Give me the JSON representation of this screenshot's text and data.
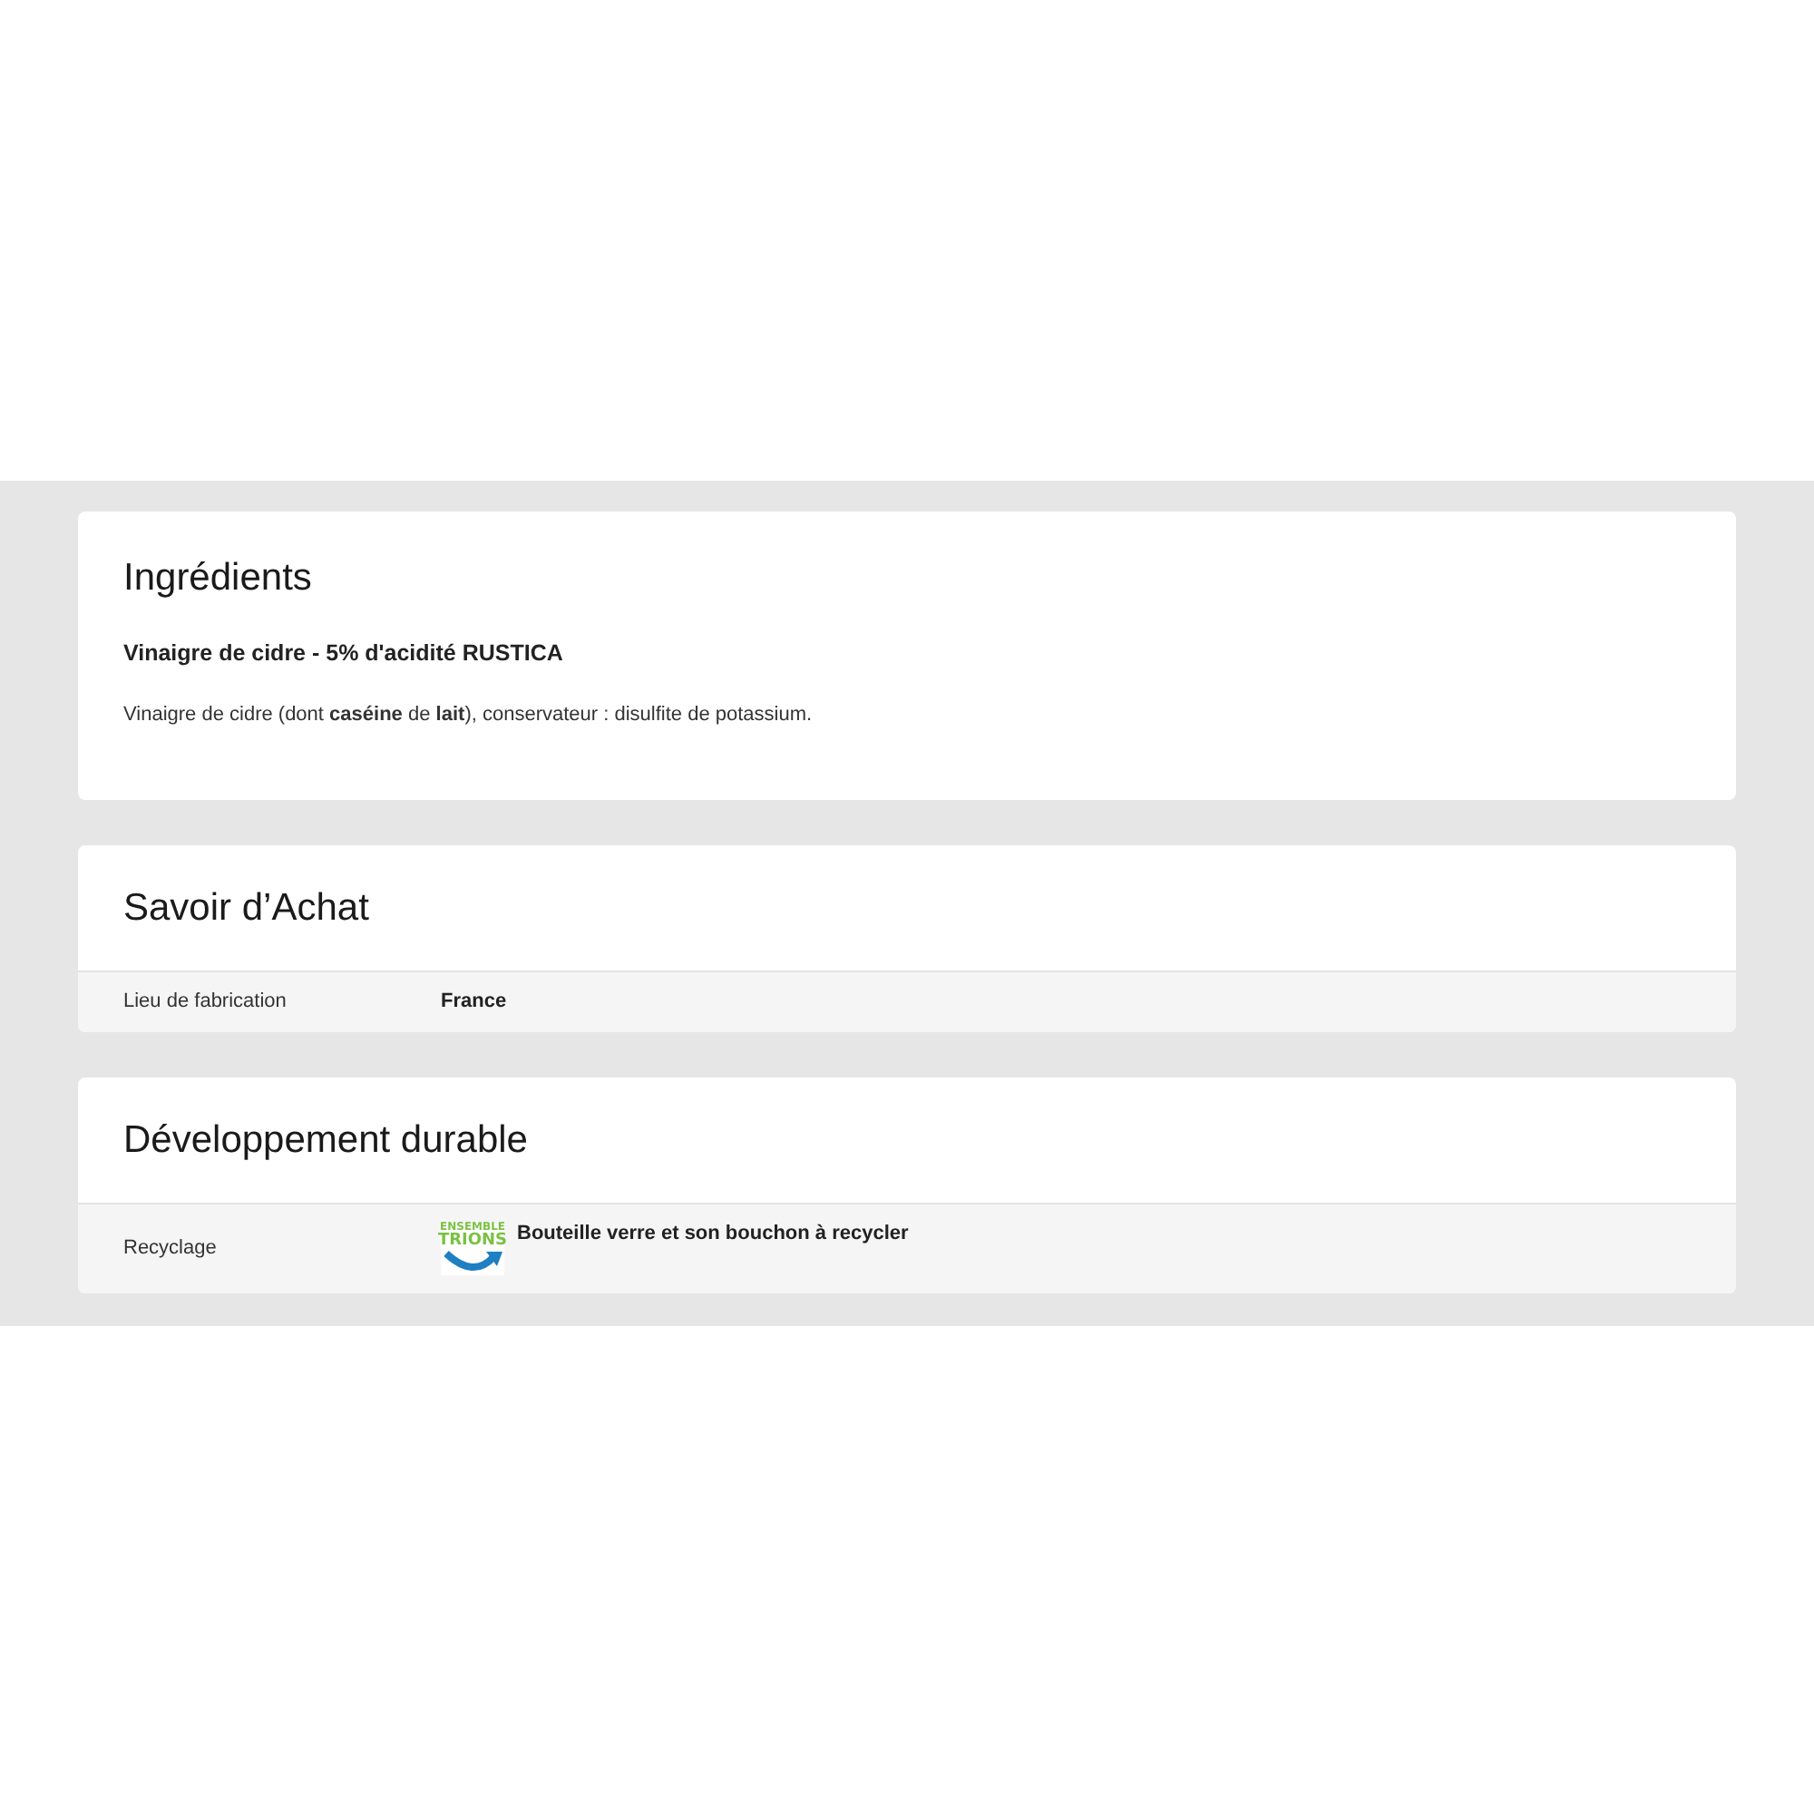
{
  "ingredients": {
    "title": "Ingrédients",
    "product": "Vinaigre de cidre - 5% d'acidité RUSTICA",
    "text": "Vinaigre de cidre (dont **caséine** de **lait**), conservateur : disulfite de potassium."
  },
  "sections": [
    {
      "title": "Savoir d’Achat",
      "rows": [
        {
          "kind": "text",
          "label": "Lieu de fabrication",
          "value": "France"
        }
      ]
    },
    {
      "title": "Développement durable",
      "rows": [
        {
          "kind": "logo",
          "label": "Recyclage",
          "logo_lines": [
            "ENSEMBLE",
            "TRIONS"
          ],
          "value": "Bouteille verre et son bouchon à recycler"
        }
      ]
    }
  ]
}
